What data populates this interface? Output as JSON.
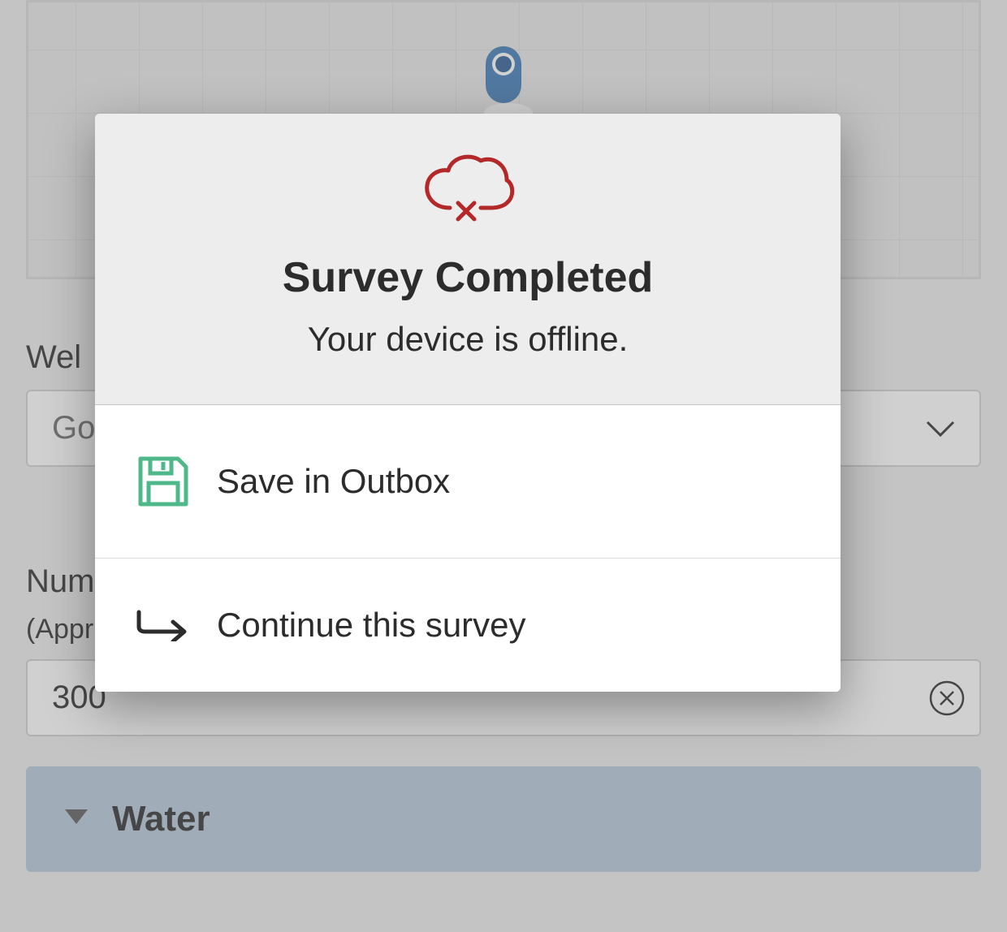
{
  "form": {
    "label_well": "Wel",
    "select_value": "Go",
    "label_number": "Num",
    "label_approx": "(Appr",
    "number_value": "300",
    "section_water": "Water"
  },
  "dialog": {
    "title": "Survey Completed",
    "subtitle": "Your device is offline.",
    "action_save": "Save in Outbox",
    "action_continue": "Continue this survey"
  }
}
